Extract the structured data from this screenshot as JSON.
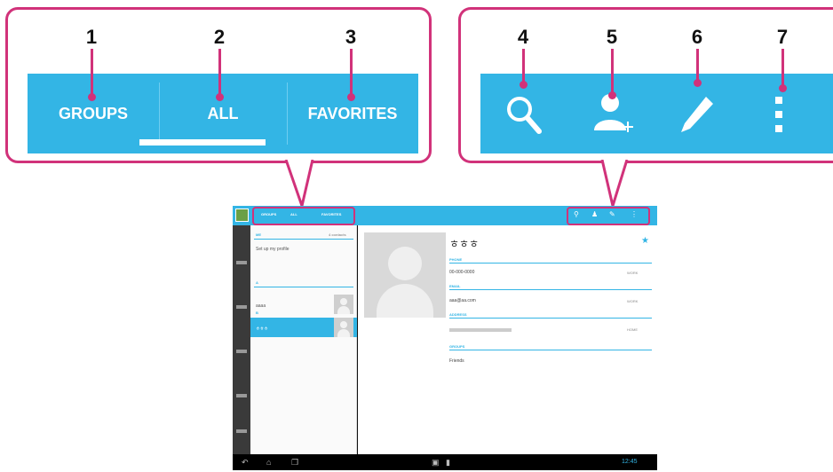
{
  "callouts": {
    "left_numbers": [
      "1",
      "2",
      "3"
    ],
    "right_numbers": [
      "4",
      "5",
      "6",
      "7"
    ],
    "tabs": [
      {
        "label": "GROUPS"
      },
      {
        "label": "ALL"
      },
      {
        "label": "FAVORITES"
      }
    ],
    "actions": [
      {
        "icon": "search-icon"
      },
      {
        "icon": "add-contact-icon"
      },
      {
        "icon": "edit-icon"
      },
      {
        "icon": "overflow-menu-icon"
      }
    ]
  },
  "tablet": {
    "mini_tabs": [
      "GROUPS",
      "ALL",
      "FAVORITES"
    ],
    "list": {
      "section_me": "ME",
      "me_count": "4 contacts",
      "me_name": "Set up my profile",
      "section_a": "A",
      "row_a": "aaaa",
      "section_b": "B",
      "row_selected": "ㅎㅎㅎ"
    },
    "detail": {
      "name": "ㅎㅎㅎ",
      "star": "★",
      "phone_header": "PHONE",
      "phone_value": "00-000-0000",
      "phone_type": "WORK",
      "email_header": "EMAIL",
      "email_value": "aaa@aa.com",
      "email_type": "WORK",
      "address_header": "ADDRESS",
      "address_type": "HOME",
      "groups_header": "GROUPS",
      "groups_value": "Friends"
    },
    "status": {
      "clock": "12:45"
    }
  },
  "colors": {
    "accent": "#33b5e5",
    "callout": "#d1327a"
  }
}
